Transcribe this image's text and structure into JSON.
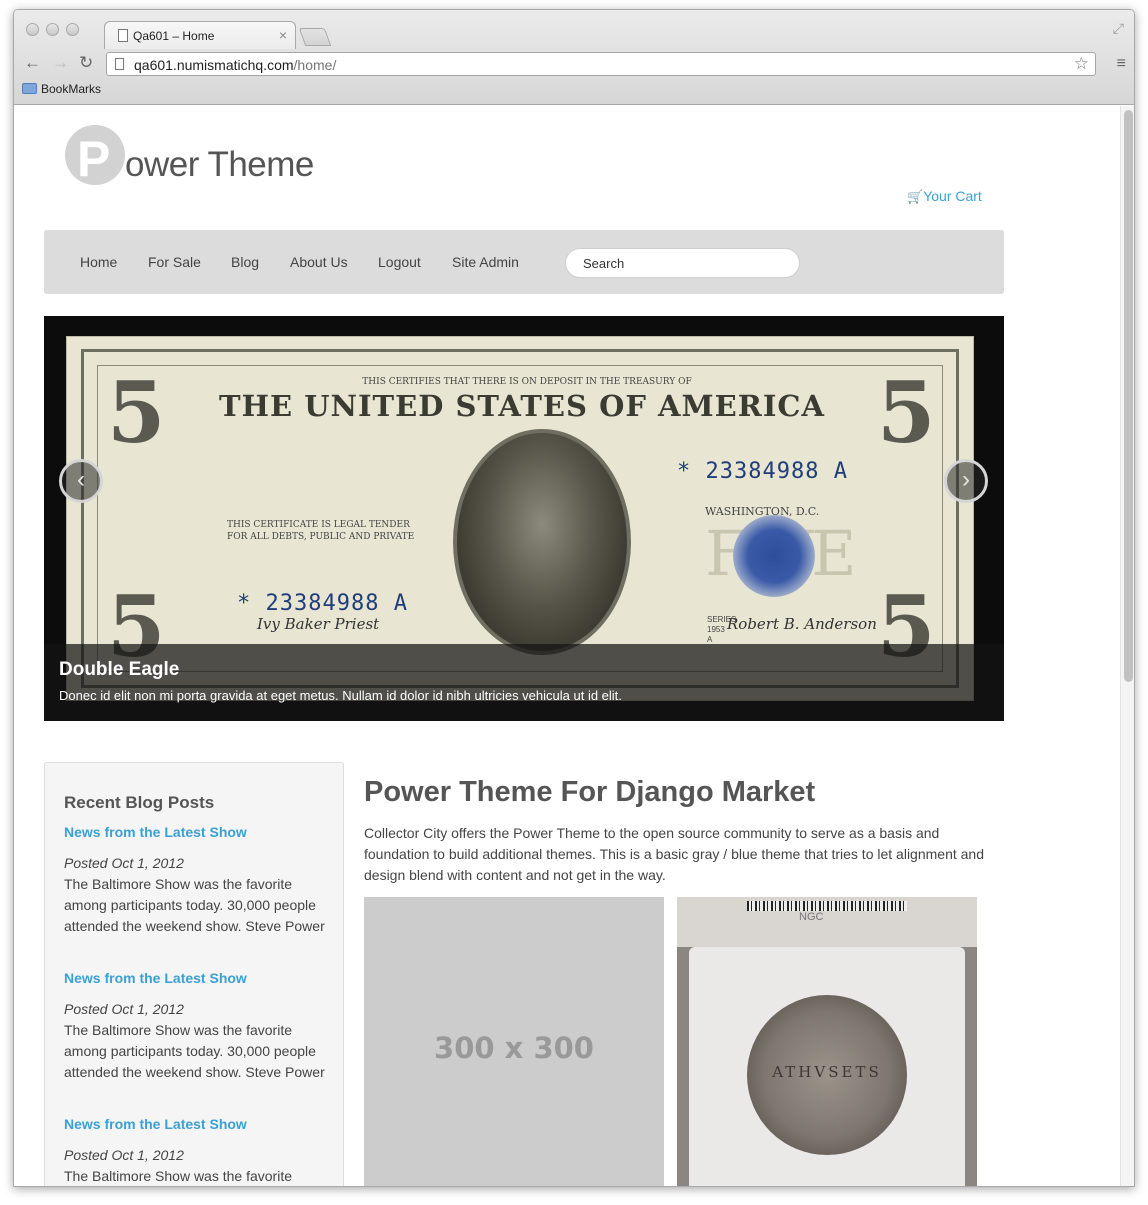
{
  "browser": {
    "tab_title": "Qa601 – Home",
    "tab_close": "×",
    "url_host": "qa601.numismatichq.com",
    "url_path": "/home/",
    "bookmarks_label": "BookMarks",
    "back_icon": "←",
    "forward_icon": "→",
    "reload_icon": "↻",
    "star_icon": "☆",
    "menu_icon": "≡",
    "resize_icon": "⤢"
  },
  "site": {
    "logo_letter": "P",
    "logo_text": "ower Theme",
    "cart_label": "Your Cart",
    "nav": [
      "Home",
      "For Sale",
      "Blog",
      "About Us",
      "Logout",
      "Site Admin"
    ],
    "search_placeholder": "Search"
  },
  "carousel": {
    "title": "Double Eagle",
    "text": "Donec id elit non mi porta gravida at eget metus. Nullam id dolor id nibh ultricies vehicula ut id elit.",
    "prev_icon": "‹",
    "next_icon": "›",
    "note": {
      "title": "THE UNITED STATES OF AMERICA",
      "subtitle": "THIS CERTIFIES THAT THERE IS ON DEPOSIT IN THE TREASURY OF",
      "serial": "* 23384988 A",
      "legal": "THIS CERTIFICATE IS LEGAL TENDER\nFOR ALL DEBTS, PUBLIC AND PRIVATE",
      "washington": "WASHINGTON, D.C.",
      "series": "SERIES\n1953\nA",
      "five": "5",
      "big_five": "FIVE",
      "sign_left": "Ivy Baker Priest",
      "sign_right": "Robert B. Anderson"
    }
  },
  "sidebar": {
    "title": "Recent Blog Posts",
    "posts": [
      {
        "title": "News from the Latest Show",
        "date": "Posted Oct 1, 2012",
        "body": "The Baltimore Show was the favorite among participants today. 30,000 people attended the weekend show. Steve Power"
      },
      {
        "title": "News from the Latest Show",
        "date": "Posted Oct 1, 2012",
        "body": "The Baltimore Show was the favorite among participants today. 30,000 people attended the weekend show. Steve Power"
      },
      {
        "title": "News from the Latest Show",
        "date": "Posted Oct 1, 2012",
        "body": "The Baltimore Show was the favorite"
      }
    ]
  },
  "main": {
    "title": "Power Theme For Django Market",
    "text": "Collector City offers the Power Theme to the open source community to serve as a basis and foundation to build additional themes. This is a basic gray / blue theme that tries to let alignment and design blend with content and not get in the way.",
    "placeholder_label": "300 x 300",
    "slab_label": "NGC",
    "coin_text": "ATHVSETS"
  }
}
